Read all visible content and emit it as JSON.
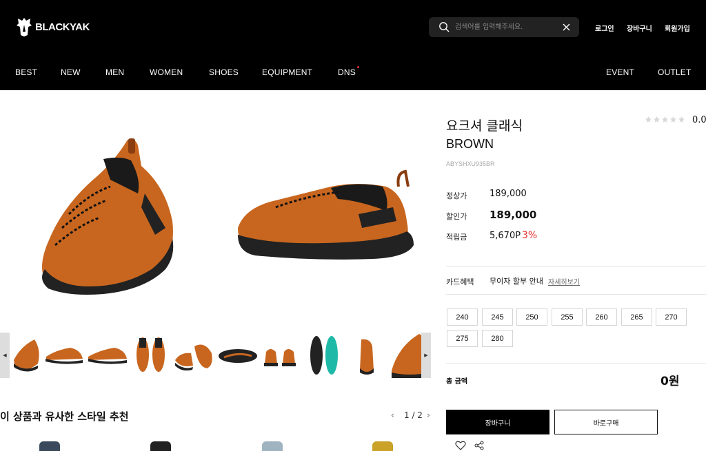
{
  "brand": {
    "name": "BLACKYAK"
  },
  "search": {
    "placeholder": "검색어를 입력해주세요."
  },
  "util": {
    "login": "로그인",
    "cart": "장바구니",
    "join": "회원가입"
  },
  "nav": {
    "items": [
      "BEST",
      "NEW",
      "MEN",
      "WOMEN",
      "SHOES",
      "EQUIPMENT",
      "DNS"
    ],
    "right": [
      "EVENT",
      "OUTLET"
    ]
  },
  "product": {
    "title": "요크셔 클래식",
    "color": "BROWN",
    "code": "ABYSHXU935BR",
    "rating": "0.0",
    "stars_filled": 0,
    "stars_total": 5,
    "price_label": "정상가",
    "price": "189,000",
    "sale_label": "할인가",
    "sale_price": "189,000",
    "point_label": "적립금",
    "point": "5,670P",
    "point_pct": "3%",
    "card_label": "카드혜택",
    "card_text": "무이자 할부 안내",
    "card_link": "자세히보기",
    "sizes": [
      "240",
      "245",
      "250",
      "255",
      "260",
      "265",
      "270",
      "275",
      "280"
    ],
    "total_label": "총 금액",
    "total": "0원",
    "cart_btn": "장바구니",
    "buy_btn": "바로구매"
  },
  "reco": {
    "title": "이 상품과 유사한 스타일 추천",
    "page": "1 / 2"
  },
  "colors": {
    "accent": "#e5322d",
    "shoe": "#c8661f",
    "sole": "#222222",
    "insole": "#1fb9a8"
  }
}
